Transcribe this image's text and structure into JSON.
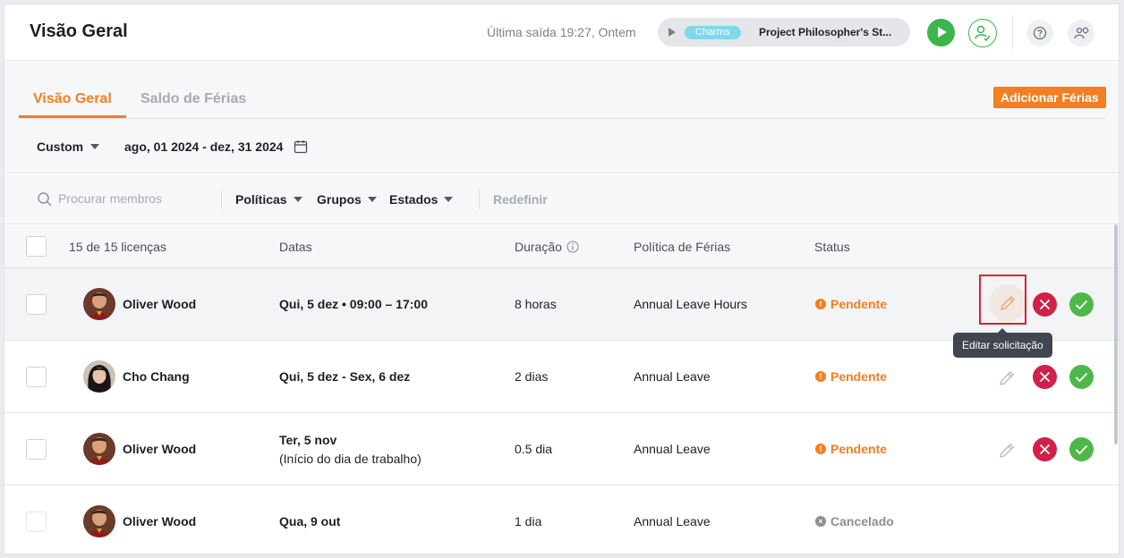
{
  "header": {
    "title": "Visão Geral",
    "last_exit": "Última saída 19:27, Ontem",
    "timer": {
      "tag": "Charms",
      "project": "Project Philosopher's St..."
    }
  },
  "tabs": [
    {
      "label": "Visão Geral",
      "active": true
    },
    {
      "label": "Saldo de Férias",
      "active": false
    }
  ],
  "add_button": "Adicionar Férias",
  "date_filter": {
    "preset": "Custom",
    "range": "ago, 01 2024 - dez, 31 2024"
  },
  "filters": {
    "search_placeholder": "Procurar membros",
    "policies": "Políticas",
    "groups": "Grupos",
    "states": "Estados",
    "reset": "Redefinir"
  },
  "table": {
    "count": "15 de 15 licenças",
    "columns": {
      "dates": "Datas",
      "duration": "Duração",
      "policy": "Política de Férias",
      "status": "Status"
    },
    "rows": [
      {
        "name": "Oliver Wood",
        "dates": "Qui, 5 dez • 09:00 – 17:00",
        "dates_sub": "",
        "duration": "8 horas",
        "policy": "Annual Leave Hours",
        "status": "Pendente"
      },
      {
        "name": "Cho Chang",
        "dates": "Qui, 5 dez - Sex, 6 dez",
        "dates_sub": "",
        "duration": "2 dias",
        "policy": "Annual Leave",
        "status": "Pendente"
      },
      {
        "name": "Oliver Wood",
        "dates": "Ter, 5 nov",
        "dates_sub": "(Início do dia de trabalho)",
        "duration": "0.5 dia",
        "policy": "Annual Leave",
        "status": "Pendente"
      },
      {
        "name": "Oliver Wood",
        "dates": "Qua, 9 out",
        "dates_sub": "",
        "duration": "1 dia",
        "policy": "Annual Leave",
        "status": "Cancelado"
      }
    ]
  },
  "tooltip": "Editar solicitação",
  "colors": {
    "accent": "#f47e20",
    "approve": "#4fb74a",
    "reject": "#d1204a",
    "cancelled": "#8a8f97",
    "highlight": "#e0212c"
  }
}
